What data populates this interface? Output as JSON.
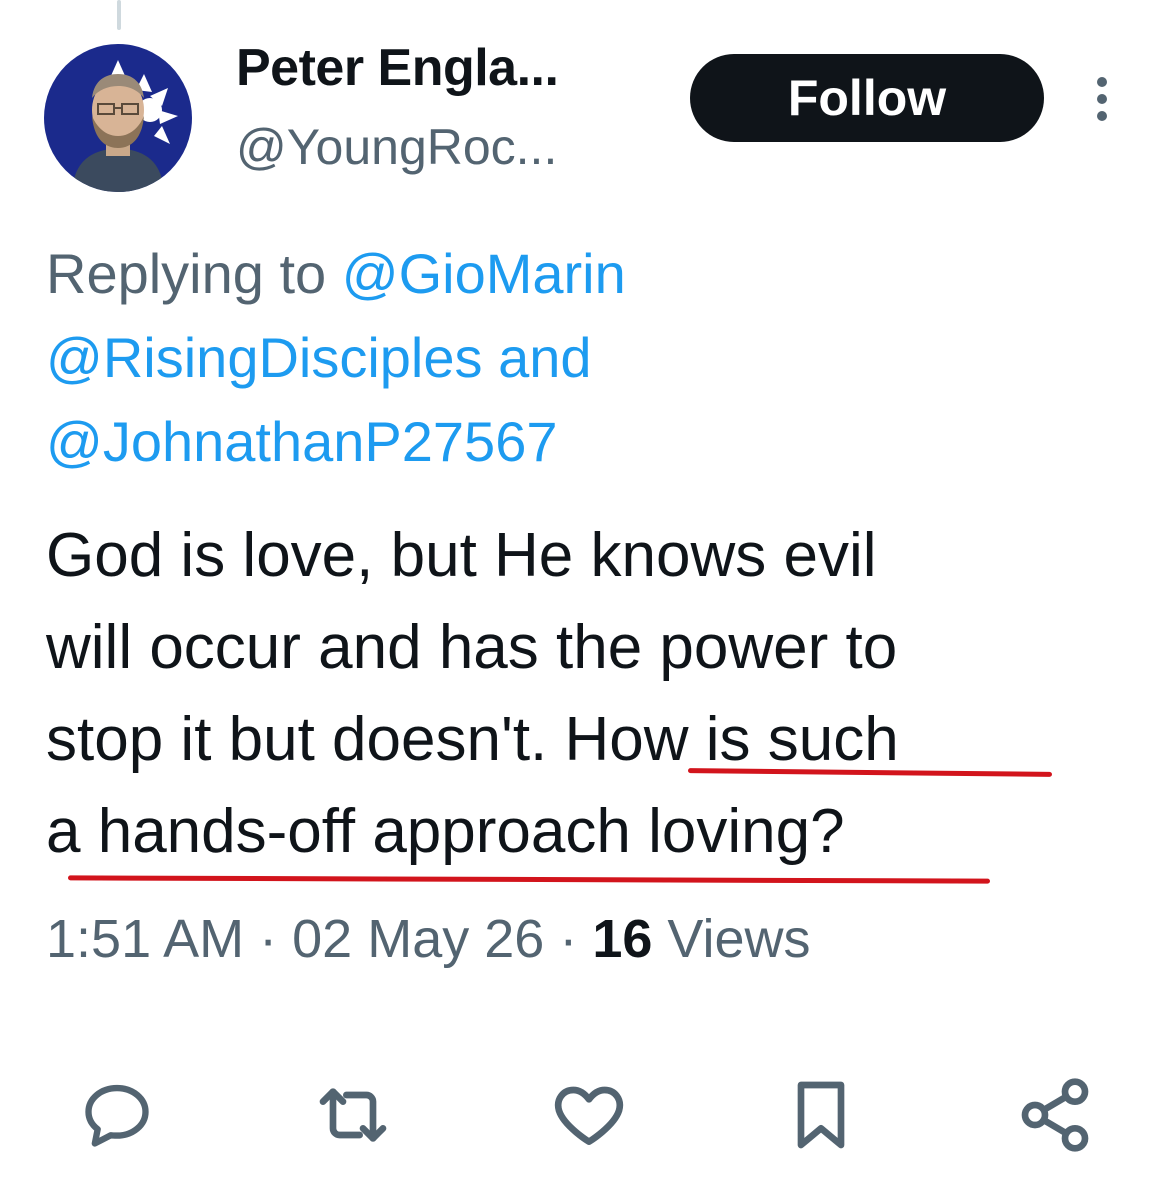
{
  "author": {
    "display_name": "Peter Engla...",
    "handle": "@YoungRoc..."
  },
  "follow_button": {
    "label": "Follow"
  },
  "reply_context": {
    "prefix": "Replying to",
    "mentions": [
      "@GioMarin",
      "@RisingDisciples",
      "@JohnathanP27567"
    ],
    "conjunction": "and"
  },
  "tweet": {
    "lines": [
      "God is love, but He knows evil",
      "will occur and has the power to",
      "stop it but doesn't.",
      "How is such",
      "a hands-off approach loving?"
    ]
  },
  "meta": {
    "time": "1:51 AM",
    "separator": "·",
    "date": "02 May 26",
    "views_count": "16",
    "views_label": "Views"
  },
  "actions": [
    {
      "icon": "reply-icon"
    },
    {
      "icon": "retweet-icon"
    },
    {
      "icon": "like-icon"
    },
    {
      "icon": "bookmark-icon"
    },
    {
      "icon": "share-icon"
    }
  ],
  "colors": {
    "text": "#0f1419",
    "secondary": "#536471",
    "link": "#1d9bf0",
    "annotation_underline": "#d2141c",
    "avatar_background": "#1b2a8c"
  }
}
